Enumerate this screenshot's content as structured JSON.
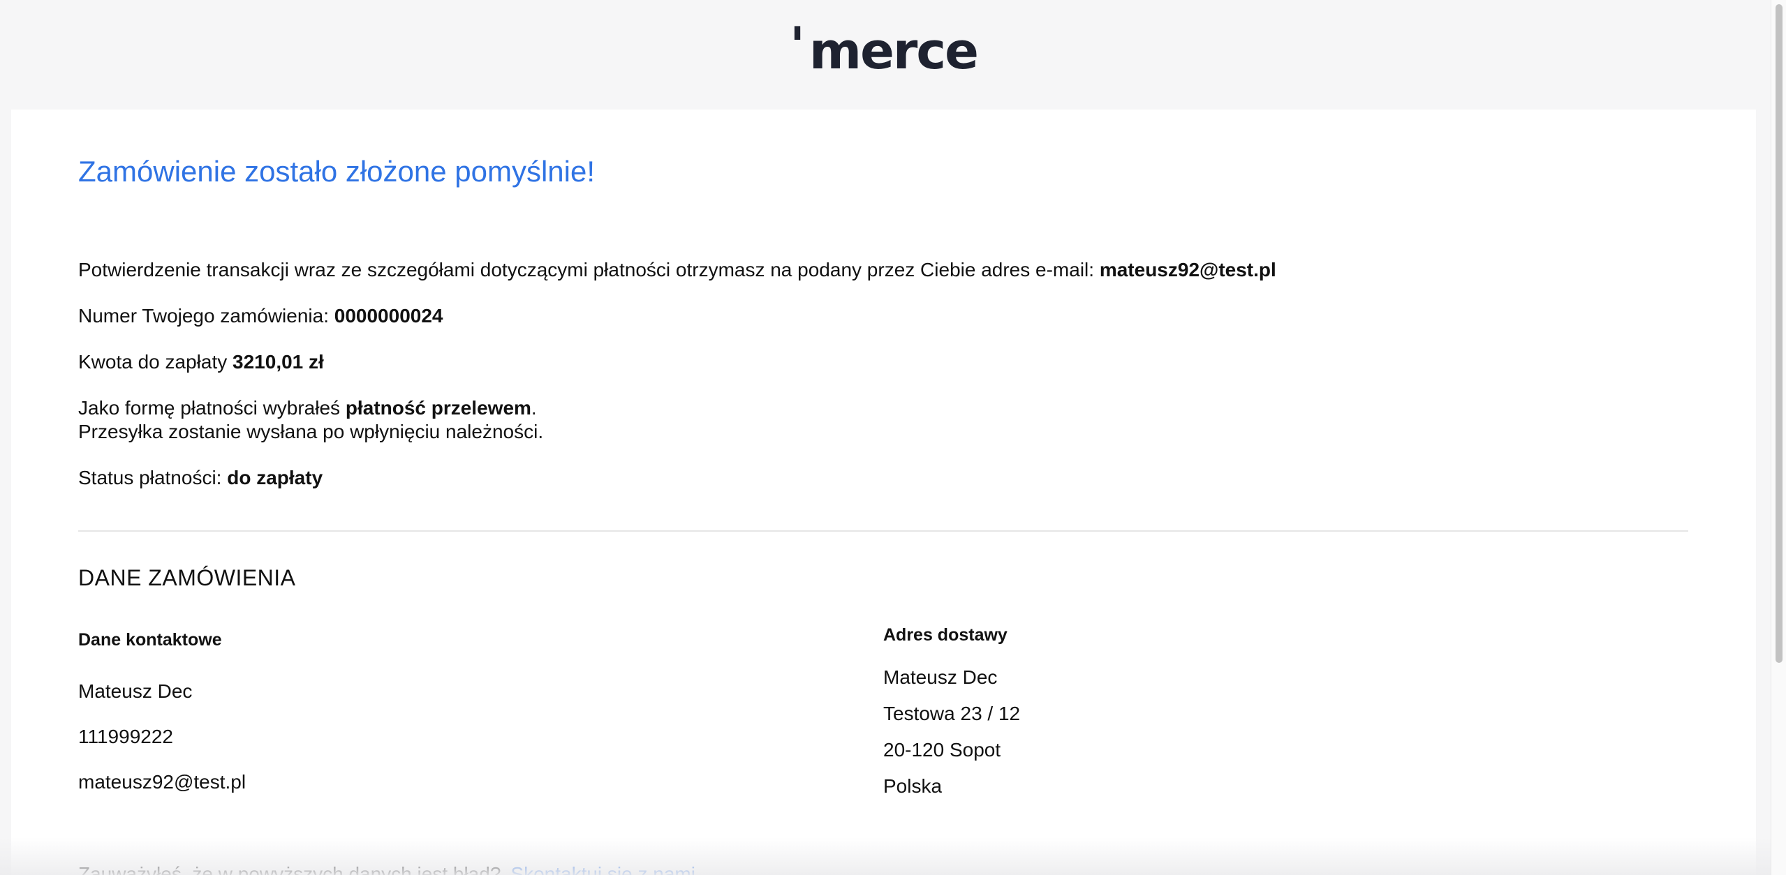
{
  "brand": {
    "logo_tick": "'",
    "logo_text": "merce",
    "colors": {
      "logo": "#1e2230",
      "accent": "#2f73e4",
      "page_background": "#f6f6f7",
      "card_background": "#ffffff"
    }
  },
  "confirmation": {
    "title": "Zamówienie zostało złożone pomyślnie!",
    "email_notice_prefix": "Potwierdzenie transakcji wraz ze szczegółami dotyczącymi płatności otrzymasz na podany przez Ciebie adres e-mail: ",
    "email": "mateusz92@test.pl",
    "order_number_label": "Numer Twojego zamówienia: ",
    "order_number": "0000000024",
    "amount_label": "Kwota do zapłaty ",
    "amount": "3210,01 zł",
    "payment_method_prefix": "Jako formę płatności wybrałeś ",
    "payment_method": "płatność przelewem",
    "payment_method_suffix": ".",
    "shipping_note": "Przesyłka zostanie wysłana po wpłynięciu należności.",
    "status_label": "Status płatności: ",
    "status_value": "do zapłaty"
  },
  "order_details": {
    "section_title": "DANE ZAMÓWIENIA",
    "contact": {
      "heading": "Dane kontaktowe",
      "name": "Mateusz Dec",
      "phone": "111999222",
      "email": "mateusz92@test.pl"
    },
    "delivery": {
      "heading": "Adres dostawy",
      "name": "Mateusz Dec",
      "street": "Testowa 23 / 12",
      "city": "20-120 Sopot",
      "country": "Polska"
    }
  },
  "footer": {
    "error_question": "Zauważyłeś, że w powyższych danych jest błąd?",
    "contact_link": "Skontaktuj się z nami"
  }
}
